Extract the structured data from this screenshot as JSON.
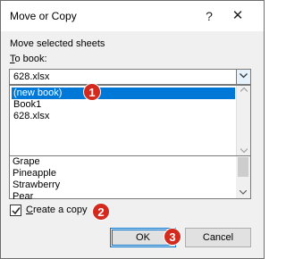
{
  "dialog": {
    "title": "Move or Copy",
    "help_glyph": "?",
    "close_glyph": "✕"
  },
  "move_label": "Move selected sheets",
  "to_book_label_acc": "T",
  "to_book_label_rest": "o book:",
  "to_book": {
    "value": "628.xlsx",
    "options": [
      {
        "label": "(new book)",
        "selected": true
      },
      {
        "label": "Book1",
        "selected": false
      },
      {
        "label": "628.xlsx",
        "selected": false
      }
    ]
  },
  "sheets": [
    "Grape",
    "Pineapple",
    "Strawberry",
    "Pear"
  ],
  "create_copy": {
    "checked": true,
    "label_acc": "C",
    "label_rest": "reate a copy"
  },
  "buttons": {
    "ok": "OK",
    "cancel": "Cancel"
  },
  "markers": [
    "1",
    "2",
    "3"
  ],
  "colors": {
    "selection": "#0078d7",
    "marker": "#d42a1e",
    "dialog_bg": "#f0f0f0"
  }
}
